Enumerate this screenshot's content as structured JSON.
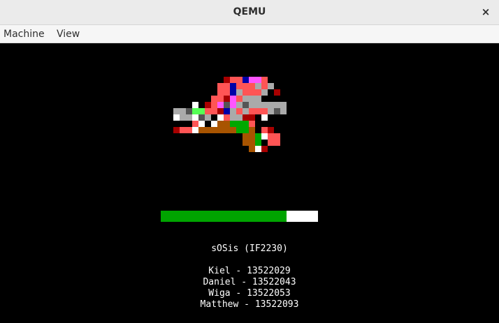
{
  "window": {
    "title": "QEMU",
    "close_glyph": "×"
  },
  "menu": {
    "items": [
      "Machine",
      "View"
    ]
  },
  "boot": {
    "title_line": "sOSis (IF2230)",
    "members": [
      "Kiel - 13522029",
      "Daniel - 13522043",
      "Wiga - 13522053",
      "Matthew - 13522093"
    ],
    "progress_fraction": 0.8
  },
  "colors": {
    "progress_fill": "#00a400",
    "progress_track": "#ffffff",
    "screen_bg": "#000000"
  },
  "sprite": {
    "cell": 9,
    "palette": {
      "1": "#a80000",
      "2": "#ff5555",
      "3": "#0000a8",
      "4": "#ff55ff",
      "5": "#aaaaaa",
      "6": "#555555",
      "7": "#ffffff",
      "8": "#55ff55",
      "9": "#00a800",
      "A": "#a85400",
      "B": "#aa00aa"
    },
    "rows": [
      "........1223442.....",
      ".......223222525....",
      ".......22352225.1...",
      "......22142555......",
      "...7.1246456555555..",
      "556882213525222565..",
      "755765.725511.7.....",
      "...27.7AA9992.......",
      "1227AAAAAA99A.21....",
      "...........AA9722...",
      "...........AA9.22...",
      "............A71....."
    ]
  }
}
